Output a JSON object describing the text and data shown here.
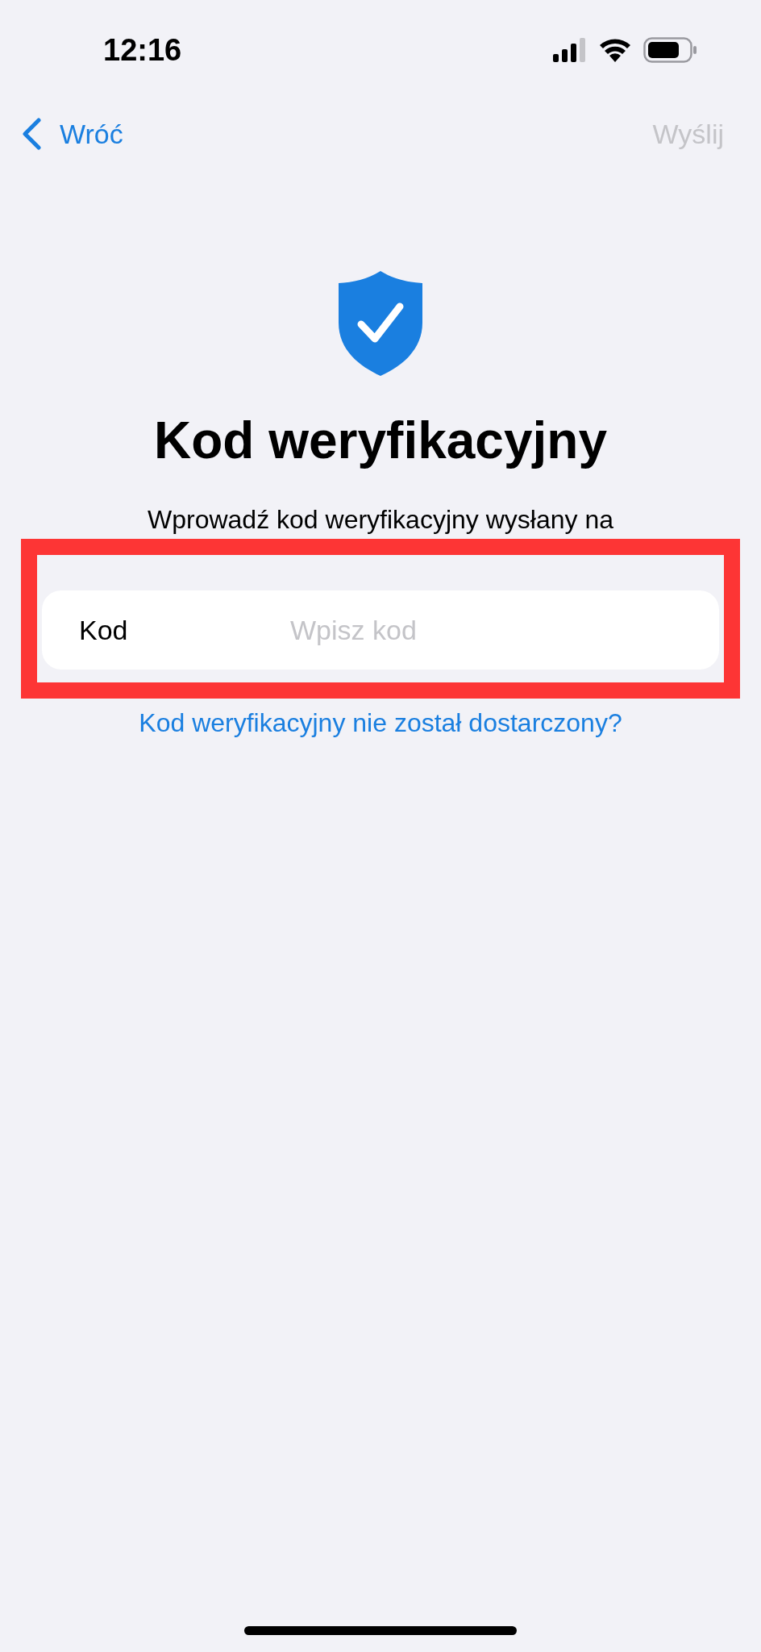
{
  "status_bar": {
    "time": "12:16"
  },
  "nav": {
    "back": "Wróć",
    "action": "Wyślij",
    "action_disabled": true
  },
  "title": "Kod weryfikacyjny",
  "subtitle": "Wprowadź kod weryfikacyjny wysłany na",
  "field": {
    "label": "Kod",
    "placeholder": "Wpisz kod"
  },
  "link": "Kod weryfikacyjny nie został dostarczony?"
}
